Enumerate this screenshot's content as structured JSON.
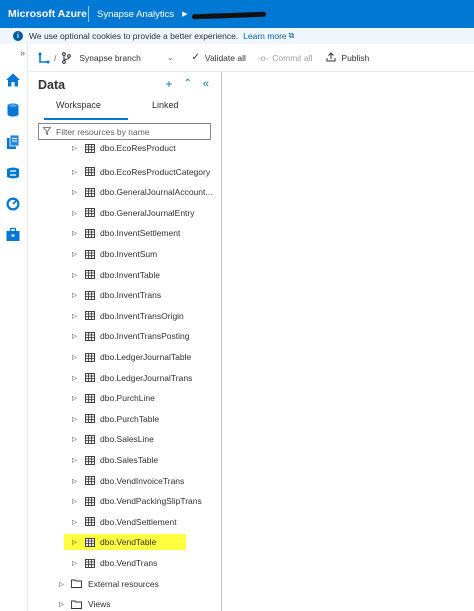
{
  "topbar": {
    "brand": "Microsoft Azure",
    "service": "Synapse Analytics"
  },
  "cookie": {
    "message": "We use optional cookies to provide a better experience.",
    "link": "Learn more"
  },
  "toolbar": {
    "slash": "/",
    "branch": "Synapse branch",
    "validate_all": "Validate all",
    "commit_all": "Commit all",
    "publish": "Publish"
  },
  "panel": {
    "title": "Data",
    "tabs": [
      "Workspace",
      "Linked"
    ],
    "filter_placeholder": "Filter resources by name"
  },
  "tree": {
    "tables": [
      "dbo.EcoResProduct",
      "dbo.EcoResProductCategory",
      "dbo.GeneralJournalAccount...",
      "dbo.GeneralJournalEntry",
      "dbo.InventSettlement",
      "dbo.InventSum",
      "dbo.InventTable",
      "dbo.InventTrans",
      "dbo.InventTransOrigin",
      "dbo.InventTransPosting",
      "dbo.LedgerJournalTable",
      "dbo.LedgerJournalTrans",
      "dbo.PurchLine",
      "dbo.PurchTable",
      "dbo.SalesLine",
      "dbo.SalesTable",
      "dbo.VendInvoiceTrans",
      "dbo.VendPackingSlipTrans",
      "dbo.VendSettlement",
      "dbo.VendTable",
      "dbo.VendTrans"
    ],
    "highlighted": "dbo.VendTable",
    "folders": [
      "External resources",
      "Views"
    ]
  },
  "colors": {
    "azure_blue": "#0078d4",
    "highlight": "#ffff40"
  },
  "icons": {
    "rail": [
      "home-icon",
      "database-icon",
      "document-icon",
      "integrate-icon",
      "monitor-icon",
      "manage-icon"
    ]
  }
}
